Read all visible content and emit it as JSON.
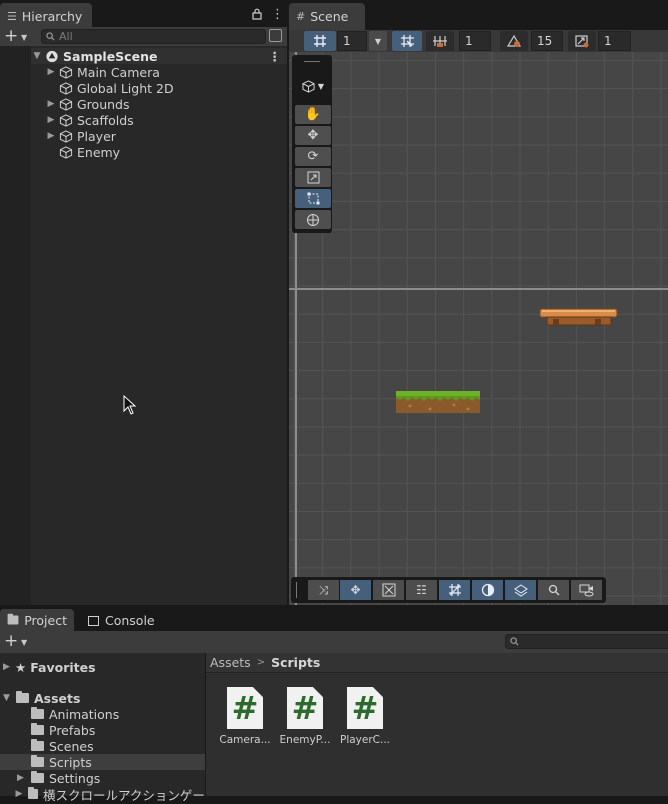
{
  "hierarchy": {
    "tab_label": "Hierarchy",
    "search_placeholder": "All",
    "scene": "SampleScene",
    "items": [
      {
        "label": "Main Camera",
        "expandable": true
      },
      {
        "label": "Global Light 2D",
        "expandable": false
      },
      {
        "label": "Grounds",
        "expandable": true
      },
      {
        "label": "Scaffolds",
        "expandable": true
      },
      {
        "label": "Player",
        "expandable": true
      },
      {
        "label": "Enemy",
        "expandable": false
      }
    ]
  },
  "scene": {
    "tab_label": "Scene",
    "grid_size": "1",
    "snap_increment": "1",
    "rotate_snap": "15",
    "scale_snap": "1"
  },
  "project": {
    "tabs": [
      {
        "label": "Project",
        "active": true
      },
      {
        "label": "Console",
        "active": false
      }
    ],
    "favorites": "Favorites",
    "assets": "Assets",
    "folders": [
      "Animations",
      "Prefabs",
      "Scenes",
      "Scripts",
      "Settings",
      "横スクロールアクションゲーム画像素"
    ],
    "selected_folder": "Scripts",
    "breadcrumb": [
      "Assets",
      "Scripts"
    ],
    "files": [
      "Camera...",
      "EnemyP...",
      "PlayerC..."
    ]
  },
  "colors": {
    "accent_blue": "#46607c",
    "grass_green": "#6fb22a",
    "dirt_brown": "#8a5a2b",
    "script_hash_green": "#2d6b2d"
  }
}
